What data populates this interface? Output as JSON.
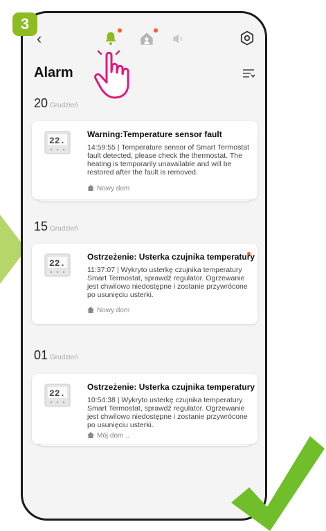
{
  "step_number": "3",
  "header": {
    "title": "Alarm",
    "back_icon": "chevron-left-icon",
    "tabs": [
      "bell-icon",
      "home-person-icon",
      "speaker-icon"
    ],
    "settings_icon": "gear-icon",
    "filter_icon": "filter-list-icon"
  },
  "groups": [
    {
      "day": "20",
      "month": "Grudzień",
      "alarm": {
        "title": "Warning:Temperature sensor fault",
        "body": "14:59:55 | Temperature sensor of Smart Termostat fault detected, please check the thermostat. The heating is temporarily unavailable and will be restored after the fault is removed.",
        "home": "Nowy dom"
      }
    },
    {
      "day": "15",
      "month": "Grudzień",
      "alarm": {
        "title": "Ostrzeżenie: Usterka czujnika temperatury",
        "body": "11:37:07 | Wykryto usterkę czujnika temperatury Smart Termostat, sprawdź regulator. Ogrzewanie jest chwilowo niedostępne i zostanie przywrócone po usunięciu usterki.",
        "home": "Nowy dom"
      }
    },
    {
      "day": "01",
      "month": "Grudzień",
      "alarm": {
        "title": "Ostrzeżenie: Usterka czujnika temperatury",
        "body": "10:54:38 | Wykryto usterkę czujnika temperatury Smart Termostat, sprawdź regulator. Ogrzewanie jest chwilowo niedostępne i zostanie przywrócone po usunięciu usterki.",
        "home": "Mój dom .."
      }
    }
  ],
  "colors": {
    "accent_green": "#8dbb21",
    "notification_dot": "#ff5a2a",
    "hand_pointer": "#e0197d"
  }
}
